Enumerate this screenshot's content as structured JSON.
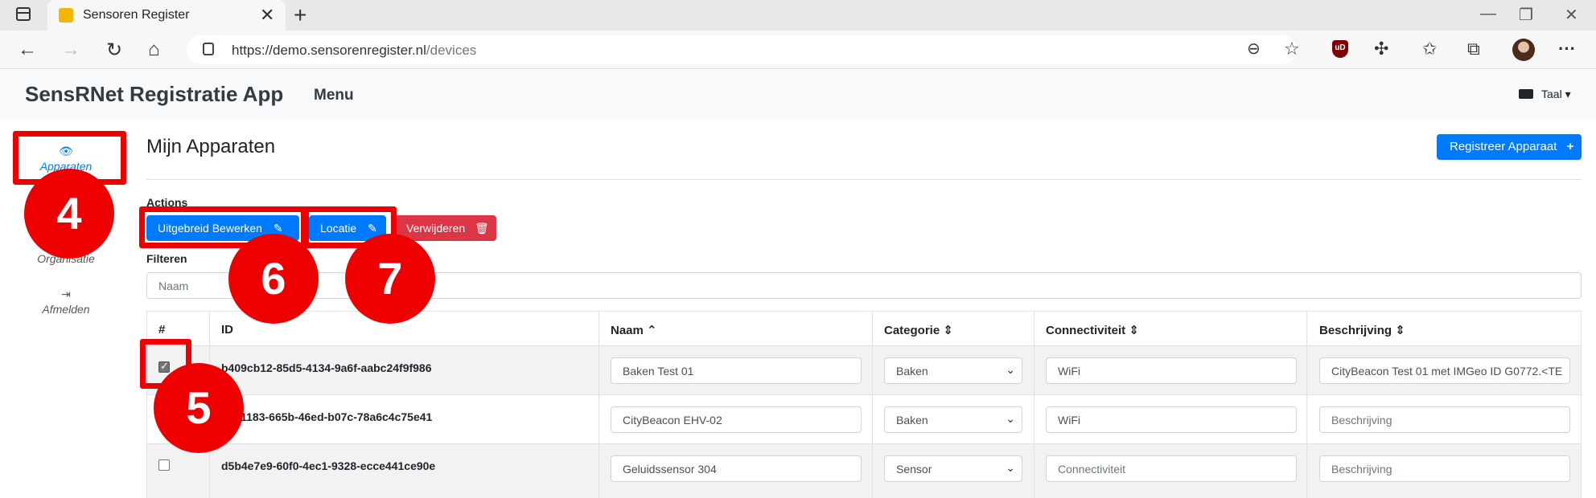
{
  "browser": {
    "tab_title": "Sensoren Register",
    "tab_close": "✕",
    "new_tab": "+",
    "url_host": "https://demo.sensorenregister.nl",
    "url_path": "/devices",
    "ublock_label": "uD"
  },
  "app": {
    "brand": "SensRNet Registratie App",
    "menu": "Menu",
    "language": "Taal ▾"
  },
  "nav": {
    "apparaten": "Apparaten",
    "organisatie": "Organisatie",
    "afmelden": "Afmelden"
  },
  "page": {
    "title": "Mijn Apparaten",
    "register_button": "Registreer Apparaat",
    "actions_label": "Actions",
    "btn_extended_edit": "Uitgebreid Bewerken",
    "btn_location": "Locatie",
    "btn_delete": "Verwijderen",
    "filter_label": "Filteren",
    "filter_placeholder": "Naam"
  },
  "table": {
    "headers": {
      "hash": "#",
      "id": "ID",
      "naam": "Naam ⌃",
      "categorie": "Categorie ⇕",
      "connectiviteit": "Connectiviteit ⇕",
      "beschrijving": "Beschrijving ⇕"
    },
    "rows": [
      {
        "id": "b409cb12-85d5-4134-9a6f-aabc24f9f986",
        "naam": "Baken Test 01",
        "categorie": "Baken",
        "connectiviteit": "WiFi",
        "beschrijving": "CityBeacon Test 01 met IMGeo ID G0772.<TE",
        "checked": true
      },
      {
        "id": "d551183-665b-46ed-b07c-78a6c4c75e41",
        "naam": "CityBeacon EHV-02",
        "categorie": "Baken",
        "connectiviteit": "WiFi",
        "beschrijving": "Beschrijving",
        "checked": false
      },
      {
        "id": "d5b4e7e9-60f0-4ec1-9328-ecce441ce90e",
        "naam": "Geluidssensor 304",
        "categorie": "Sensor",
        "connectiviteit": "Connectiviteit",
        "beschrijving": "Beschrijving",
        "checked": false
      }
    ]
  },
  "annotations": {
    "n4": "4",
    "n5": "5",
    "n6": "6",
    "n7": "7",
    "color": "#ee0000"
  }
}
